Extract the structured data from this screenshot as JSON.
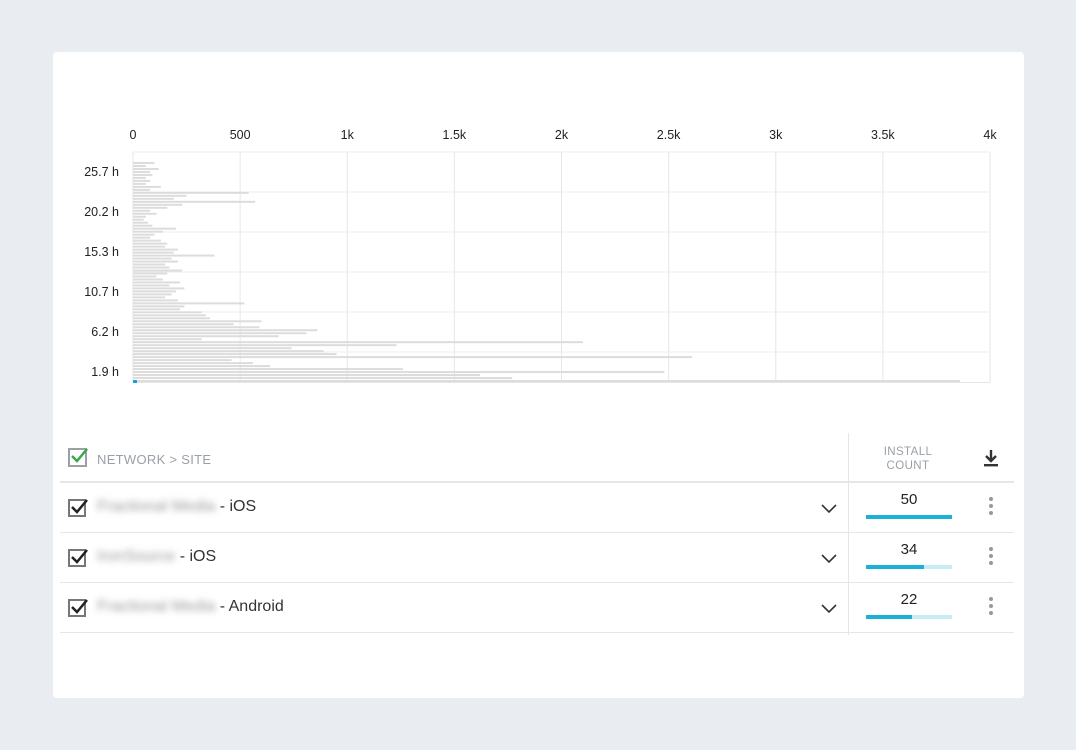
{
  "chart_data": {
    "type": "bar",
    "orientation": "horizontal",
    "x_ticks": [
      "0",
      "500",
      "1k",
      "1.5k",
      "2k",
      "2.5k",
      "3k",
      "3.5k",
      "4k"
    ],
    "xlim": [
      0,
      4000
    ],
    "y_ticks": [
      "25.7 h",
      "20.2 h",
      "15.3 h",
      "10.7 h",
      "6.2 h",
      "1.9 h"
    ],
    "grid": true,
    "bar_color": "#dcdcdc",
    "highlight_color": "#1aa0d8",
    "values": [
      3860,
      1770,
      1620,
      2480,
      1260,
      640,
      560,
      460,
      2610,
      950,
      890,
      740,
      1230,
      2100,
      320,
      680,
      810,
      860,
      590,
      470,
      600,
      360,
      340,
      320,
      220,
      240,
      520,
      210,
      150,
      180,
      200,
      240,
      170,
      220,
      140,
      110,
      160,
      230,
      170,
      150,
      210,
      180,
      380,
      190,
      210,
      150,
      160,
      130,
      80,
      100,
      140,
      200,
      90,
      70,
      50,
      60,
      110,
      80,
      160,
      230,
      570,
      190,
      250,
      540,
      80,
      130,
      60,
      80,
      60,
      90,
      80,
      120,
      60,
      100
    ]
  },
  "table": {
    "header": {
      "label": "NETWORK > SITE",
      "col_label_line1": "INSTALL",
      "col_label_line2": "COUNT"
    },
    "rows": [
      {
        "name_blurred": "Fractional Media",
        "suffix": " - iOS",
        "count": "50",
        "fraction": 1.0
      },
      {
        "name_blurred": "IronSource",
        "suffix": " - iOS",
        "count": "34",
        "fraction": 0.68
      },
      {
        "name_blurred": "Fractional Media",
        "suffix": " - Android",
        "count": "22",
        "fraction": 0.53
      }
    ]
  }
}
